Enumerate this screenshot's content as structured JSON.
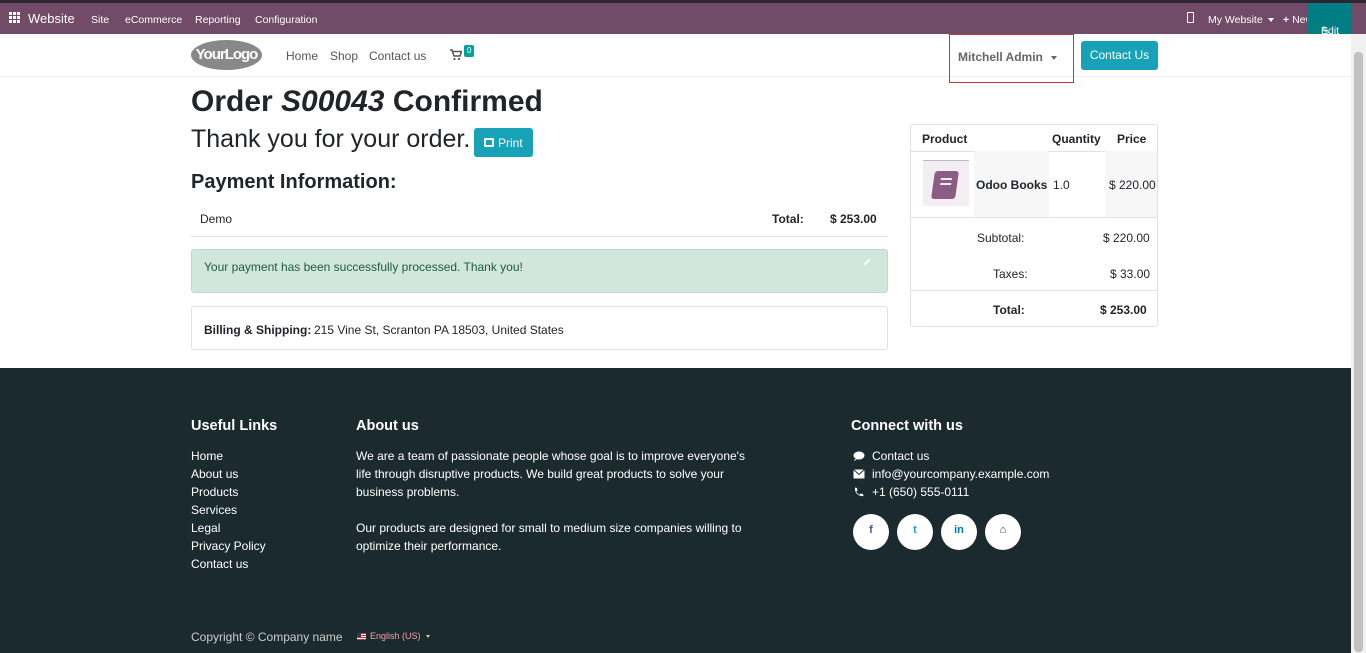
{
  "adminbar": {
    "brand": "Website",
    "menus": [
      "Site",
      "eCommerce",
      "Reporting",
      "Configuration"
    ],
    "my_website": "My Website",
    "new_label": "New",
    "edit_label": "Edit"
  },
  "navbar": {
    "logo_text": "YourLogo",
    "links": [
      "Home",
      "Shop",
      "Contact us"
    ],
    "cart_count": "0",
    "user_name": "Mitchell Admin",
    "contact_button": "Contact Us"
  },
  "order": {
    "title_prefix": "Order",
    "order_number": "S00043",
    "title_suffix": "Confirmed",
    "thank_you": "Thank you for your order.",
    "print_label": "Print",
    "payment_heading": "Payment Information:",
    "payment_method": "Demo",
    "total_label": "Total:",
    "total_value": "$ 253.00",
    "alert_message": "Your payment has been successfully processed. Thank you!",
    "billing_label": "Billing & Shipping:",
    "billing_address": "215 Vine St, Scranton PA 18503, United States"
  },
  "summary": {
    "headers": [
      "Product",
      "Quantity",
      "Price"
    ],
    "product_name": "Odoo Books",
    "quantity": "1.0",
    "price": "$ 220.00",
    "subtotal_label": "Subtotal:",
    "subtotal_value": "$ 220.00",
    "taxes_label": "Taxes:",
    "taxes_value": "$ 33.00",
    "total_label": "Total:",
    "total_value": "$ 253.00"
  },
  "footer": {
    "useful_links_heading": "Useful Links",
    "useful_links": [
      "Home",
      "About us",
      "Products",
      "Services",
      "Legal",
      "Privacy Policy",
      "Contact us"
    ],
    "about_heading": "About us",
    "about_p1": "We are a team of passionate people whose goal is to improve everyone's life through disruptive products. We build great products to solve your business problems.",
    "about_p2": "Our products are designed for small to medium size companies willing to optimize their performance.",
    "connect_heading": "Connect with us",
    "connect_items": [
      "Contact us",
      "info@yourcompany.example.com",
      "+1 (650) 555-0111"
    ],
    "social": [
      "f",
      "t",
      "in",
      "⌂"
    ],
    "copyright": "Copyright © Company name",
    "language": "English (US)"
  },
  "colors": {
    "admin_bar": "#714b67",
    "edit_button": "#017e84",
    "primary_button": "#17a2b8",
    "success_alert": "#d1e7dd",
    "footer_bg": "#1b2a2f"
  }
}
